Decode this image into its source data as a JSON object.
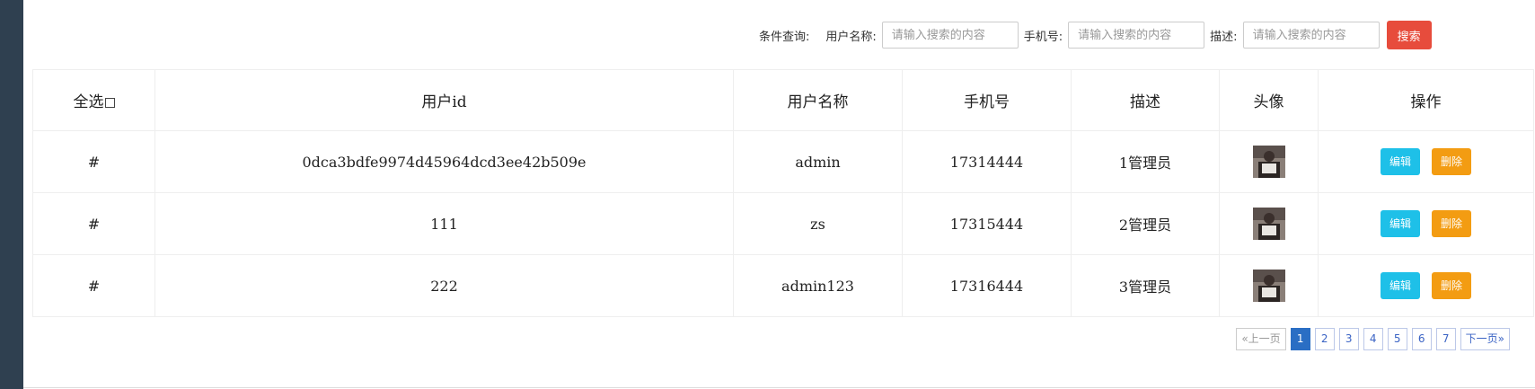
{
  "search": {
    "condition_label": "条件查询:",
    "username_label": "用户名称:",
    "phone_label": "手机号:",
    "desc_label": "描述:",
    "placeholder": "请输入搜索的内容",
    "button_label": "搜索"
  },
  "table": {
    "headers": {
      "select_all": "全选",
      "user_id": "用户id",
      "username": "用户名称",
      "phone": "手机号",
      "desc": "描述",
      "avatar": "头像",
      "actions": "操作"
    },
    "rows": [
      {
        "mark": "#",
        "user_id": "0dca3bdfe9974d45964dcd3ee42b509e",
        "username": "admin",
        "phone": "17314444",
        "desc": "1管理员"
      },
      {
        "mark": "#",
        "user_id": "111",
        "username": "zs",
        "phone": "17315444",
        "desc": "2管理员"
      },
      {
        "mark": "#",
        "user_id": "222",
        "username": "admin123",
        "phone": "17316444",
        "desc": "3管理员"
      }
    ],
    "edit_label": "编辑",
    "delete_label": "删除"
  },
  "pagination": {
    "prev": "«上一页",
    "pages": [
      "1",
      "2",
      "3",
      "4",
      "5",
      "6",
      "7"
    ],
    "current": "1",
    "next": "下一页»"
  },
  "colors": {
    "search_button": "#e74c3c",
    "edit_button": "#1ec0e8",
    "delete_button": "#f39c12",
    "active_page": "#2a6ec4",
    "sidebar": "#2f4050"
  }
}
